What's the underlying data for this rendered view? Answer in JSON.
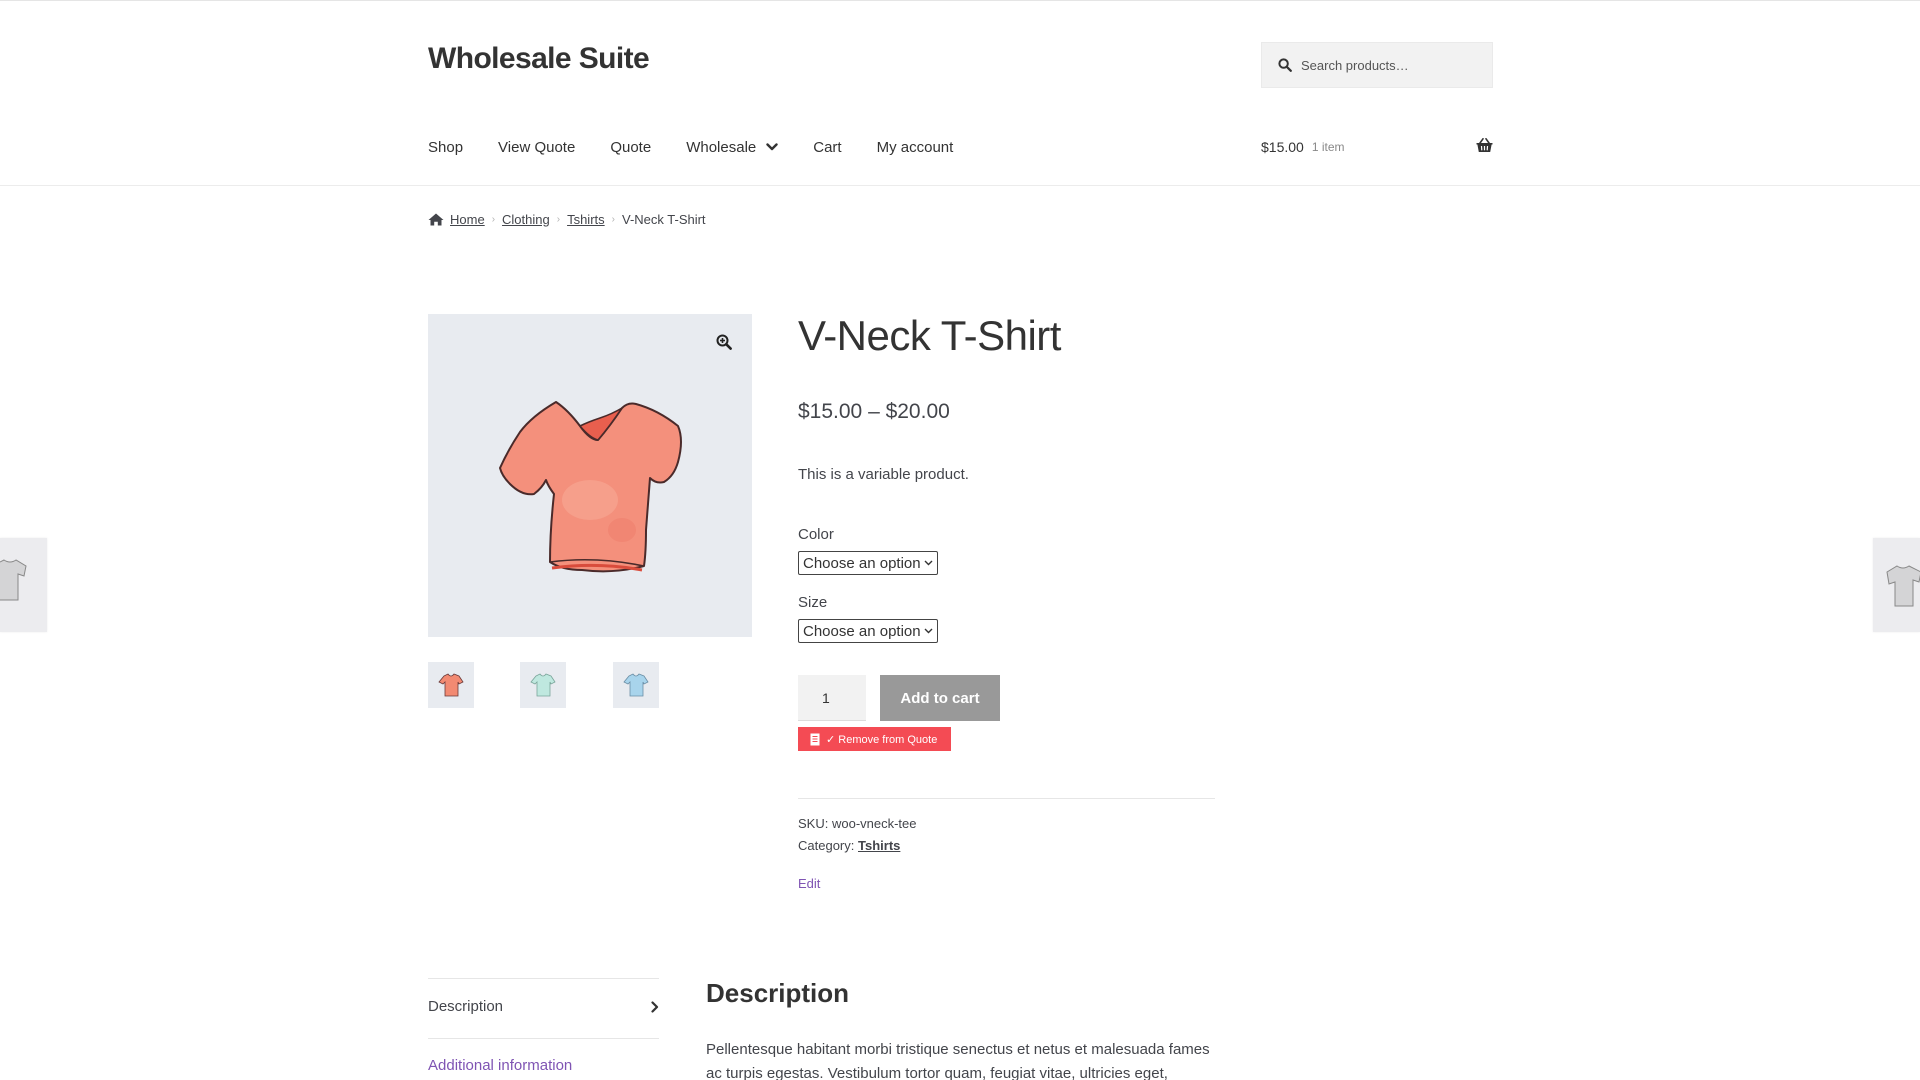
{
  "site": {
    "title": "Wholesale Suite"
  },
  "search": {
    "placeholder": "Search products…"
  },
  "nav": {
    "items": [
      {
        "label": "Shop"
      },
      {
        "label": "View Quote"
      },
      {
        "label": "Quote"
      },
      {
        "label": "Wholesale",
        "has_dropdown": true
      },
      {
        "label": "Cart"
      },
      {
        "label": "My account"
      }
    ]
  },
  "cart": {
    "amount": "$15.00",
    "count": "1 item"
  },
  "breadcrumb": {
    "home": "Home",
    "clothing": "Clothing",
    "tshirts": "Tshirts",
    "current": "V-Neck T-Shirt"
  },
  "product": {
    "title": "V-Neck T-Shirt",
    "price": "$15.00 – $20.00",
    "short_description": "This is a variable product.",
    "color_label": "Color",
    "color_select": "Choose an option",
    "size_label": "Size",
    "size_select": "Choose an option",
    "quantity": "1",
    "add_to_cart": "Add to cart",
    "quote_button": "✓ Remove from Quote",
    "sku_label": "SKU:",
    "sku": "woo-vneck-tee",
    "category_label": "Category:",
    "category": "Tshirts",
    "edit": "Edit"
  },
  "gallery": {
    "thumbnail_colors": [
      "#f28a72",
      "#bfe8df",
      "#a8d4ec"
    ],
    "main_color": "#f4907c"
  },
  "tabs": {
    "description": "Description",
    "additional": "Additional information"
  },
  "description": {
    "heading": "Description",
    "body": "Pellentesque habitant morbi tristique senectus et netus et malesuada fames ac turpis egestas. Vestibulum tortor quam, feugiat vitae, ultricies eget,"
  },
  "colors": {
    "accent_purple": "#7f54b3",
    "quote_red": "#f44b54",
    "button_gray": "#999999"
  }
}
